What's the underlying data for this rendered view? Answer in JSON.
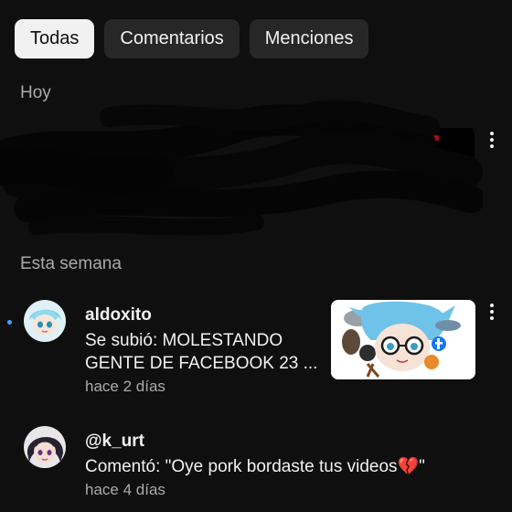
{
  "tabs": [
    {
      "label": "Todas",
      "active": true
    },
    {
      "label": "Comentarios",
      "active": false
    },
    {
      "label": "Menciones",
      "active": false
    }
  ],
  "sections": {
    "today": "Hoy",
    "this_week": "Esta semana"
  },
  "notifications": [
    {
      "username": "aldoxito",
      "line1": "Se subió: MOLESTANDO",
      "line2": "GENTE DE FACEBOOK 23 ...",
      "time": "hace 2 días",
      "unread": true
    },
    {
      "username": "@k_urt",
      "text": "Comentó: \"Oye pork bordaste tus videos💔\"",
      "time": "hace 4 días",
      "unread": false
    }
  ],
  "colors": {
    "background": "#0f0f0f",
    "chip": "#272727",
    "chip_active": "#f1f1f1",
    "unread_dot": "#3ea6ff",
    "secondary_text": "#aaaaaa"
  },
  "icons": [
    "more-vert-icon"
  ]
}
